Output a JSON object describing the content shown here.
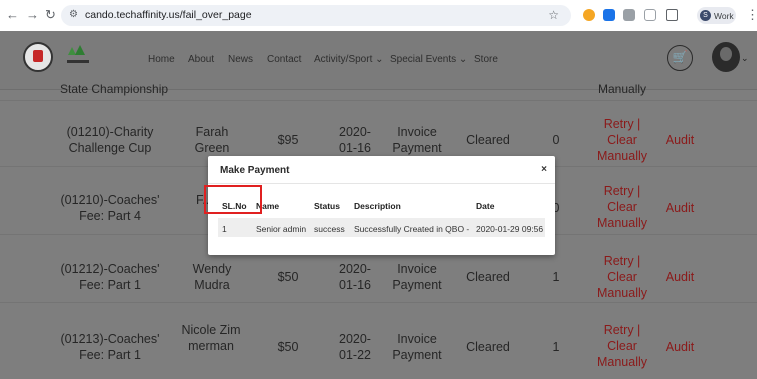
{
  "browser": {
    "url": "cando.techaffinity.us/fail_over_page",
    "profile_label": "Work",
    "profile_initial": "S"
  },
  "header": {
    "nav": [
      "Home",
      "About",
      "News",
      "Contact",
      "Activity/Sport ⌄",
      "Special Events ⌄",
      "Store"
    ],
    "cart_icon": "cart-icon",
    "avatar_icon": "user-avatar"
  },
  "table": {
    "top_partial": {
      "name": "State Championship",
      "action": "Manually"
    },
    "rows": [
      {
        "name": "(01210)-Charity Challenge Cup",
        "person": "Farah Green",
        "amount": "$95",
        "date": "2020-01-16",
        "type": "Invoice Payment",
        "status": "Cleared",
        "count": "0",
        "action": "Retry | Clear Manually",
        "audit": "Audit"
      },
      {
        "name": "(01210)-Coaches' Fee: Part 4",
        "person": "F... G...",
        "amount": "",
        "date": "",
        "type": "",
        "status": "",
        "count": "0",
        "action": "Retry | Clear Manually",
        "audit": "Audit"
      },
      {
        "name": "(01212)-Coaches' Fee: Part 1",
        "person": "Wendy Mudra",
        "amount": "$50",
        "date": "2020-01-16",
        "type": "Invoice Payment",
        "status": "Cleared",
        "count": "1",
        "action": "Retry | Clear Manually",
        "audit": "Audit"
      },
      {
        "name": "(01213)-Coaches' Fee: Part 1",
        "person": "Nicole Zimmerman",
        "amount": "$50",
        "date": "2020-01-22",
        "type": "Invoice Payment",
        "status": "Cleared",
        "count": "1",
        "action": "Retry | Clear Manually",
        "audit": "Audit"
      }
    ]
  },
  "modal": {
    "title": "Make Payment",
    "close": "×",
    "columns": [
      "SL.No",
      "Name",
      "Status",
      "Description",
      "Date"
    ],
    "row": [
      "1",
      "Senior admin",
      "success",
      "Successfully Created in QBO -",
      "2020-01-29 09:56"
    ]
  }
}
